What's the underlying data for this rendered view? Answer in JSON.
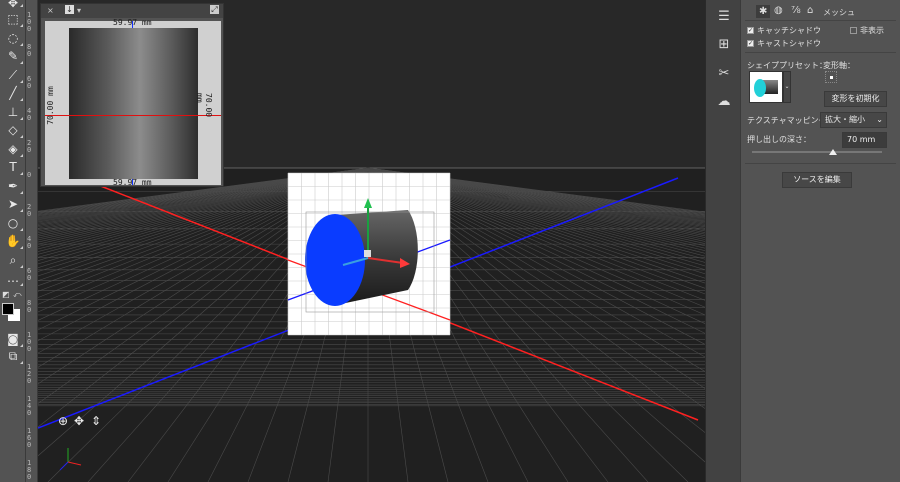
{
  "toolbar": {
    "tools": [
      {
        "name": "marquee-tool",
        "glyph": "⬚"
      },
      {
        "name": "lasso-tool",
        "glyph": "◌"
      },
      {
        "name": "quick-select-tool",
        "glyph": "✎"
      },
      {
        "name": "eyedropper-tool",
        "glyph": "⟋"
      },
      {
        "name": "brush-tool",
        "glyph": "╱"
      },
      {
        "name": "stamp-tool",
        "glyph": "⊥"
      },
      {
        "name": "eraser-tool",
        "glyph": "◇"
      },
      {
        "name": "paint-bucket-tool",
        "glyph": "◈"
      },
      {
        "name": "type-tool",
        "glyph": "T"
      },
      {
        "name": "pen-tool",
        "glyph": "✒"
      },
      {
        "name": "path-select-tool",
        "glyph": "➤"
      },
      {
        "name": "ellipse-tool",
        "glyph": "○"
      },
      {
        "name": "hand-tool",
        "glyph": "✋"
      },
      {
        "name": "zoom-tool",
        "glyph": "⌕"
      },
      {
        "name": "more-tools",
        "glyph": "…"
      }
    ],
    "colors": {
      "foreground": "#000000",
      "background": "#ffffff"
    }
  },
  "ruler": {
    "labels": [
      "100",
      "80",
      "60",
      "40",
      "20",
      "0",
      "20",
      "40",
      "60",
      "80",
      "100",
      "120",
      "140",
      "160",
      "180"
    ]
  },
  "uv_panel": {
    "top_label": "59.97 mm",
    "bottom_label": "59.97 mm",
    "left_label": "70.00 mm",
    "right_label": "70.00 mm"
  },
  "properties": {
    "tab_label": "メッシュ",
    "catch_shadow": {
      "label": "キャッチシャドウ",
      "checked": true
    },
    "cast_shadow": {
      "label": "キャストシャドウ",
      "checked": true
    },
    "invisible": {
      "label": "非表示",
      "checked": false
    },
    "shape_preset_label": "シェイププリセット：",
    "deform_axis_label": "変形軸：",
    "reset_deform_button": "変形を初期化",
    "texture_mapping_label": "テクスチャマッピング：",
    "texture_mapping_value": "拡大・縮小",
    "extrusion_depth_label": "押し出しの深さ：",
    "extrusion_depth_value": "70 mm",
    "extrusion_slider_fraction": 0.62,
    "edit_source_button": "ソースを編集"
  },
  "scene": {
    "x_axis_color": "#ff2020",
    "z_axis_color": "#1a1aff",
    "cap_color": "#0a3cff"
  }
}
